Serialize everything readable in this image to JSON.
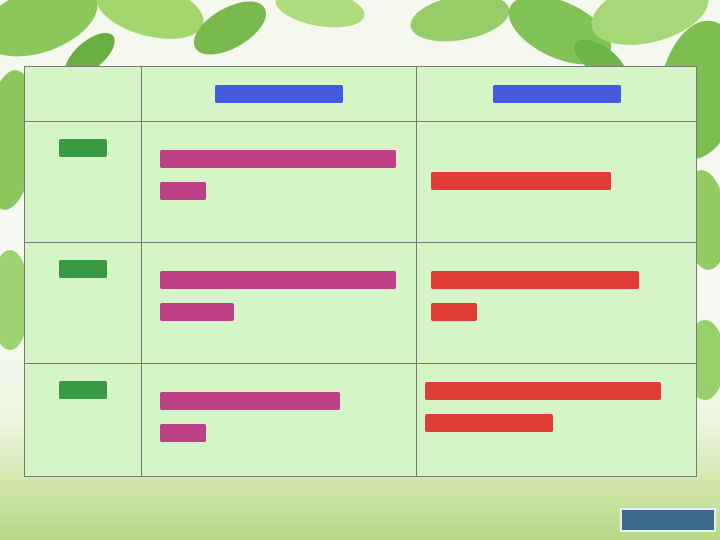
{
  "note": "Cell text in the original is unreadable, so each cell is rendered as a placeholder bar instead of guessed text.",
  "colors": {
    "header_text": "#2a3fe0",
    "row_label_text": "#1e8a2c",
    "column1_text": "#b8207a",
    "column2_text": "#e01b1b",
    "table_fill": "#d6f5c7",
    "grid_line": "#7a7a7a"
  },
  "table": {
    "headers": [
      "",
      "",
      ""
    ],
    "rows": [
      {
        "label": "",
        "col1": "",
        "col2": ""
      },
      {
        "label": "",
        "col1": "",
        "col2": ""
      },
      {
        "label": "",
        "col1": "",
        "col2": ""
      }
    ]
  }
}
